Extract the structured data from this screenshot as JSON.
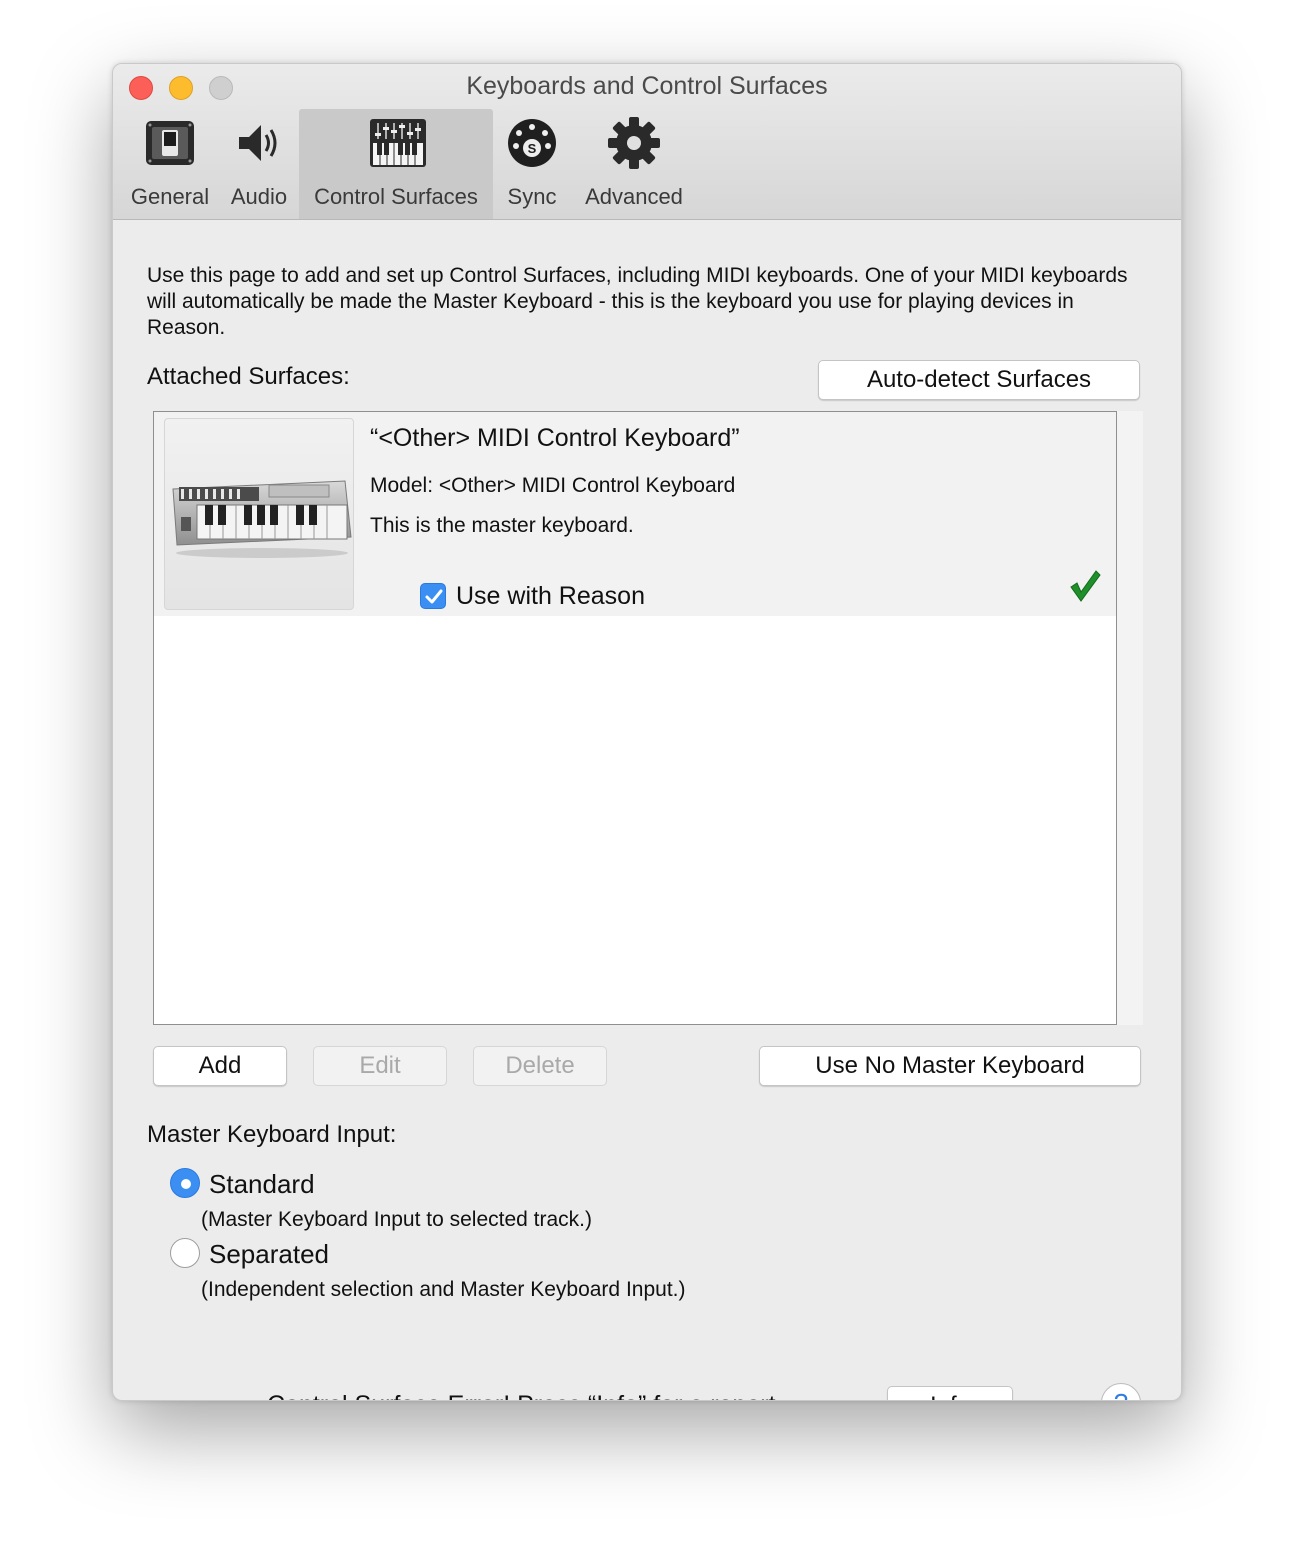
{
  "window": {
    "title": "Keyboards and Control Surfaces"
  },
  "tabs": [
    {
      "label": "General",
      "icon": "general-icon",
      "active": false
    },
    {
      "label": "Audio",
      "icon": "speaker-icon",
      "active": false
    },
    {
      "label": "Control Surfaces",
      "icon": "mixer-keyboard-icon",
      "active": true
    },
    {
      "label": "Sync",
      "icon": "midi-sync-icon",
      "active": false
    },
    {
      "label": "Advanced",
      "icon": "gear-icon",
      "active": false
    }
  ],
  "intro_text": "Use this page to add and set up Control Surfaces, including MIDI keyboards. One of your MIDI keyboards will automatically be made the Master Keyboard - this is the keyboard you use for playing devices in Reason.",
  "attached": {
    "label": "Attached Surfaces:",
    "autodetect_label": "Auto-detect Surfaces",
    "surfaces": [
      {
        "name": "“<Other> MIDI Control Keyboard”",
        "model": "Model: <Other> MIDI Control Keyboard",
        "master_note": "This is the master keyboard.",
        "use_label": "Use with Reason",
        "use_checked": true,
        "status_icon": "green-check-icon"
      }
    ]
  },
  "actions": {
    "add": "Add",
    "edit": "Edit",
    "delete": "Delete",
    "no_master": "Use No Master Keyboard"
  },
  "master_input": {
    "label": "Master Keyboard Input:",
    "options": [
      {
        "label": "Standard",
        "description": "(Master Keyboard Input to selected track.)",
        "selected": true
      },
      {
        "label": "Separated",
        "description": "(Independent selection and Master Keyboard Input.)",
        "selected": false
      }
    ]
  },
  "footer": {
    "error_text": "Control Surface Error! Press “Info” for a report.",
    "info_label": "Info",
    "help_label": "?"
  },
  "colors": {
    "accent": "#3b8ff3",
    "check_green": "#1f8f2a",
    "close": "#fc5f57",
    "minimize": "#fdbc2e"
  }
}
